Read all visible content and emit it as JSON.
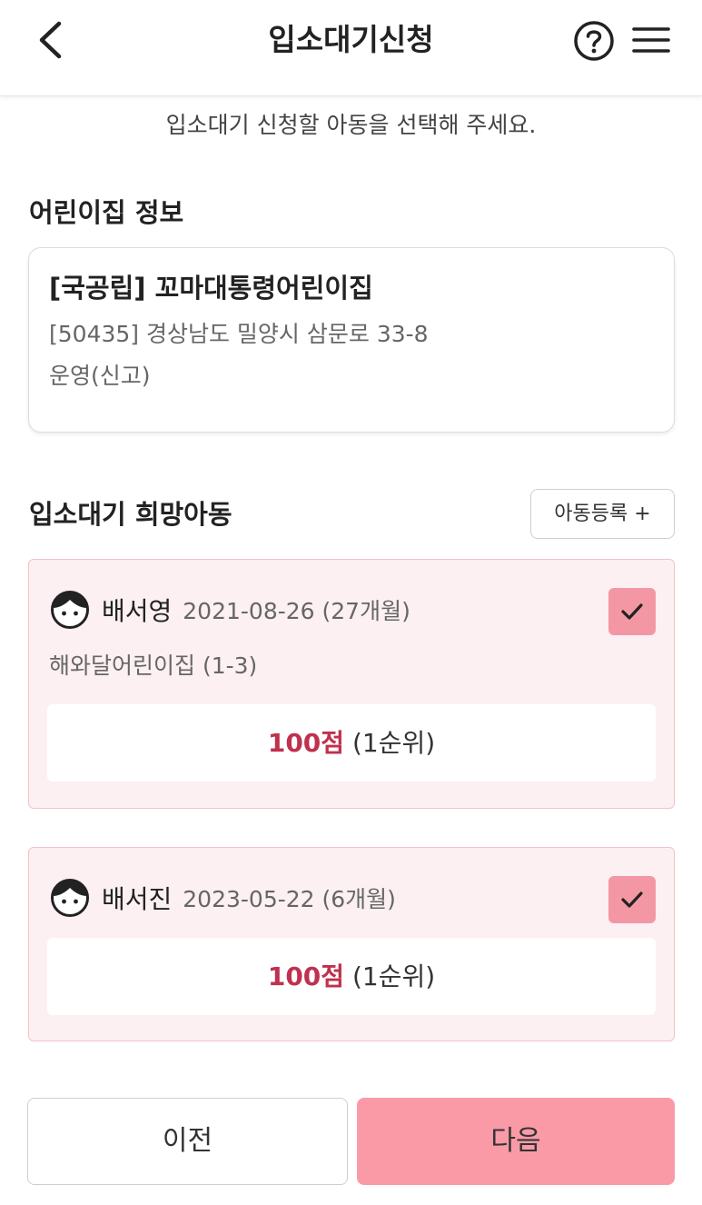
{
  "header": {
    "title": "입소대기신청"
  },
  "instruction": "입소대기 신청할 아동을 선택해 주세요.",
  "daycare_section": {
    "title": "어린이집 정보",
    "name": "[국공립] 꼬마대통령어린이집",
    "address": "[50435] 경상남도 밀양시 삼문로 33-8",
    "status": "운영(신고)"
  },
  "children_section": {
    "title": "입소대기 희망아동",
    "register_label": "아동등록 +",
    "children": [
      {
        "name": "배서영",
        "birth": "2021-08-26 (27개월)",
        "class": "해와달어린이집 (1-3)",
        "score": "100점",
        "rank": "(1순위)",
        "checked": true
      },
      {
        "name": "배서진",
        "birth": "2023-05-22 (6개월)",
        "score": "100점",
        "rank": "(1순위)",
        "checked": true
      }
    ]
  },
  "footer": {
    "prev_label": "이전",
    "next_label": "다음"
  },
  "colors": {
    "accent": "#fa9aa7",
    "card_bg": "#fcf0f2",
    "score": "#c0314e"
  },
  "icons": [
    "chevron-left-icon",
    "help-circle-icon",
    "hamburger-menu-icon",
    "child-face-icon",
    "check-icon"
  ]
}
